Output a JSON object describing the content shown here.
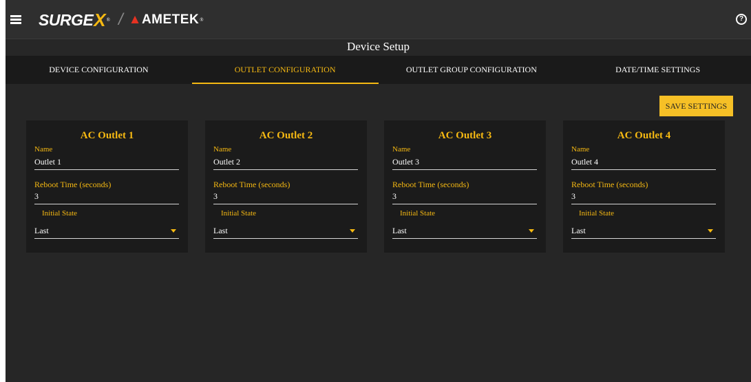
{
  "header": {
    "logo_surge": "SURGE",
    "logo_x": "X",
    "logo_ametek": "AMETEK",
    "menu_icon": "hamburger-menu-icon",
    "help_icon": "help-circle-icon",
    "help_glyph": "?"
  },
  "page_title": "Device Setup",
  "tabs": [
    {
      "label": "DEVICE CONFIGURATION",
      "active": false
    },
    {
      "label": "OUTLET CONFIGURATION",
      "active": true
    },
    {
      "label": "OUTLET GROUP CONFIGURATION",
      "active": false
    },
    {
      "label": "DATE/TIME SETTINGS",
      "active": false
    }
  ],
  "save_label": "SAVE SETTINGS",
  "outlets": [
    {
      "title": "AC Outlet 1",
      "name_label": "Name",
      "name": "Outlet 1",
      "reboot_label": "Reboot Time (seconds)",
      "reboot": "3",
      "state_label": "Initial State",
      "state": "Last"
    },
    {
      "title": "AC Outlet 2",
      "name_label": "Name",
      "name": "Outlet 2",
      "reboot_label": "Reboot Time (seconds)",
      "reboot": "3",
      "state_label": "Initial State",
      "state": "Last"
    },
    {
      "title": "AC Outlet 3",
      "name_label": "Name",
      "name": "Outlet 3",
      "reboot_label": "Reboot Time (seconds)",
      "reboot": "3",
      "state_label": "Initial State",
      "state": "Last"
    },
    {
      "title": "AC Outlet 4",
      "name_label": "Name",
      "name": "Outlet 4",
      "reboot_label": "Reboot Time (seconds)",
      "reboot": "3",
      "state_label": "Initial State",
      "state": "Last"
    }
  ],
  "colors": {
    "accent": "#f6b912",
    "background": "#262626",
    "card": "#1b1b1b"
  }
}
